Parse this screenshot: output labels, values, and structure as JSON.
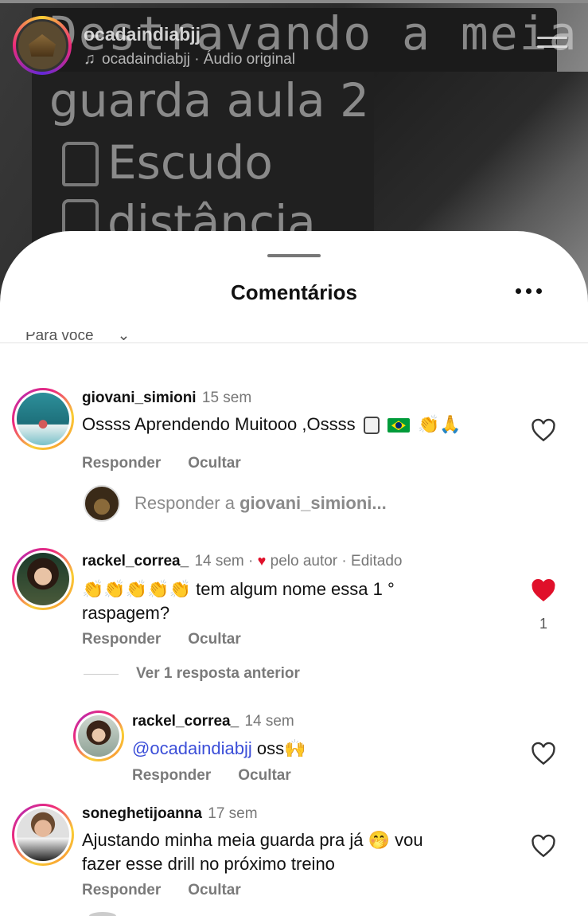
{
  "reel": {
    "username": "ocadaindiabjj",
    "audio": "ocadaindiabjj · Áudio original",
    "overlay_lines": [
      "Destravando a meia",
      "guarda aula 2",
      "Escudo",
      "distância"
    ]
  },
  "sheet": {
    "title": "Comentários",
    "filter_label": "Para você"
  },
  "comments": [
    {
      "username": "giovani_simioni",
      "time": "15 sem",
      "text": "Ossss Aprendendo Muitooo ,Ossss",
      "emoji_tail": "👏🙏",
      "reply_label": "Responder",
      "hide_label": "Ocultar",
      "liked": false
    },
    {
      "username": "rackel_correa_",
      "time": "14 sem",
      "author_like": "pelo autor",
      "edited": "· Editado",
      "emoji_lead": "👏👏👏👏👏",
      "text_line1": "tem algum nome essa 1 °",
      "text_line2": "raspagem?",
      "reply_label": "Responder",
      "hide_label": "Ocultar",
      "liked": true,
      "like_count": "1",
      "view_replies": "Ver 1 resposta anterior"
    },
    {
      "username": "rackel_correa_",
      "time": "14 sem",
      "mention": "@ocadaindiabjj",
      "text": "oss",
      "emoji_tail": "🙌",
      "reply_label": "Responder",
      "hide_label": "Ocultar",
      "liked": false
    },
    {
      "username": "soneghetijoanna",
      "time": "17 sem",
      "text_line1": "Ajustando minha meia guarda pra já",
      "text_line1_tail": "vou",
      "emoji_mid": "🤭",
      "text_line2": "fazer esse drill no próximo treino",
      "reply_label": "Responder",
      "hide_label": "Ocultar",
      "liked": false
    }
  ],
  "reply_composer": {
    "prefix": "Responder a",
    "target": "giovani_simioni..."
  },
  "colors": {
    "like_red": "#e0102a",
    "mention_blue": "#3b4ed8",
    "muted_gray": "#7a7a7a"
  }
}
